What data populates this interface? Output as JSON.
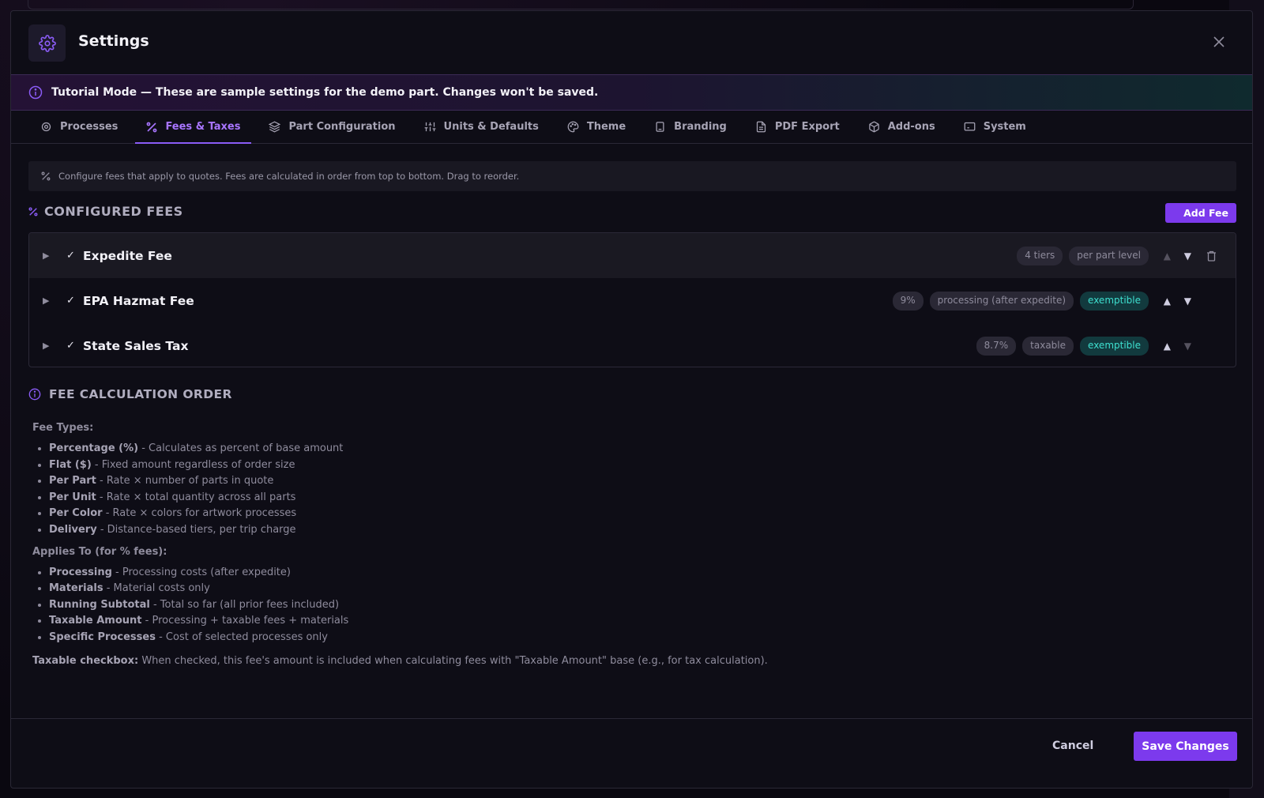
{
  "header": {
    "title": "Settings",
    "icon": "gear-icon"
  },
  "banner": {
    "text": "Tutorial Mode — These are sample settings for the demo part. Changes won't be saved."
  },
  "tabs": [
    {
      "label": "Processes",
      "icon": "gear-icon"
    },
    {
      "label": "Fees & Taxes",
      "icon": "percent-icon",
      "active": true
    },
    {
      "label": "Part Configuration",
      "icon": "layers-icon"
    },
    {
      "label": "Units & Defaults",
      "icon": "sliders-icon"
    },
    {
      "label": "Theme",
      "icon": "palette-icon"
    },
    {
      "label": "Branding",
      "icon": "bookmark-icon"
    },
    {
      "label": "PDF Export",
      "icon": "file-icon"
    },
    {
      "label": "Add-ons",
      "icon": "package-icon"
    },
    {
      "label": "System",
      "icon": "monitor-icon"
    }
  ],
  "info": {
    "text": "Configure fees that apply to quotes. Fees are calculated in order from top to bottom. Drag to reorder."
  },
  "configured": {
    "title": "CONFIGURED FEES",
    "add_label": "Add Fee"
  },
  "fees": [
    {
      "name": "Expedite Fee",
      "chips": [
        "4 tiers",
        "per part level"
      ],
      "exemptible": ""
    },
    {
      "name": "EPA Hazmat Fee",
      "chips": [
        "9%",
        "processing (after expedite)"
      ],
      "exemptible": "exemptible"
    },
    {
      "name": "State Sales Tax",
      "chips": [
        "8.7%",
        "taxable"
      ],
      "exemptible": "exemptible"
    }
  ],
  "calc": {
    "title": "FEE CALCULATION ORDER",
    "types_label": "Fee Types:",
    "types": [
      {
        "term": "Percentage (%)",
        "desc": " - Calculates as percent of base amount"
      },
      {
        "term": "Flat ($)",
        "desc": " - Fixed amount regardless of order size"
      },
      {
        "term": "Per Part",
        "desc": " - Rate × number of parts in quote"
      },
      {
        "term": "Per Unit",
        "desc": " - Rate × total quantity across all parts"
      },
      {
        "term": "Per Color",
        "desc": " - Rate × colors for artwork processes"
      },
      {
        "term": "Delivery",
        "desc": " - Distance-based tiers, per trip charge"
      }
    ],
    "applies_label": "Applies To (for % fees):",
    "applies": [
      {
        "term": "Processing",
        "desc": " - Processing costs (after expedite)"
      },
      {
        "term": "Materials",
        "desc": " - Material costs only"
      },
      {
        "term": "Running Subtotal",
        "desc": " - Total so far (all prior fees included)"
      },
      {
        "term": "Taxable Amount",
        "desc": " - Processing + taxable fees + materials"
      },
      {
        "term": "Specific Processes",
        "desc": " - Cost of selected processes only"
      }
    ],
    "note_label": "Taxable checkbox:",
    "note_text": " When checked, this fee's amount is included when calculating fees with \"Taxable Amount\" base (e.g., for tax calculation)."
  },
  "footer": {
    "cancel": "Cancel",
    "save": "Save Changes"
  },
  "colors": {
    "accent": "#7c3aed",
    "accent_text": "#a875ff",
    "teal": "#3ee0d0"
  }
}
